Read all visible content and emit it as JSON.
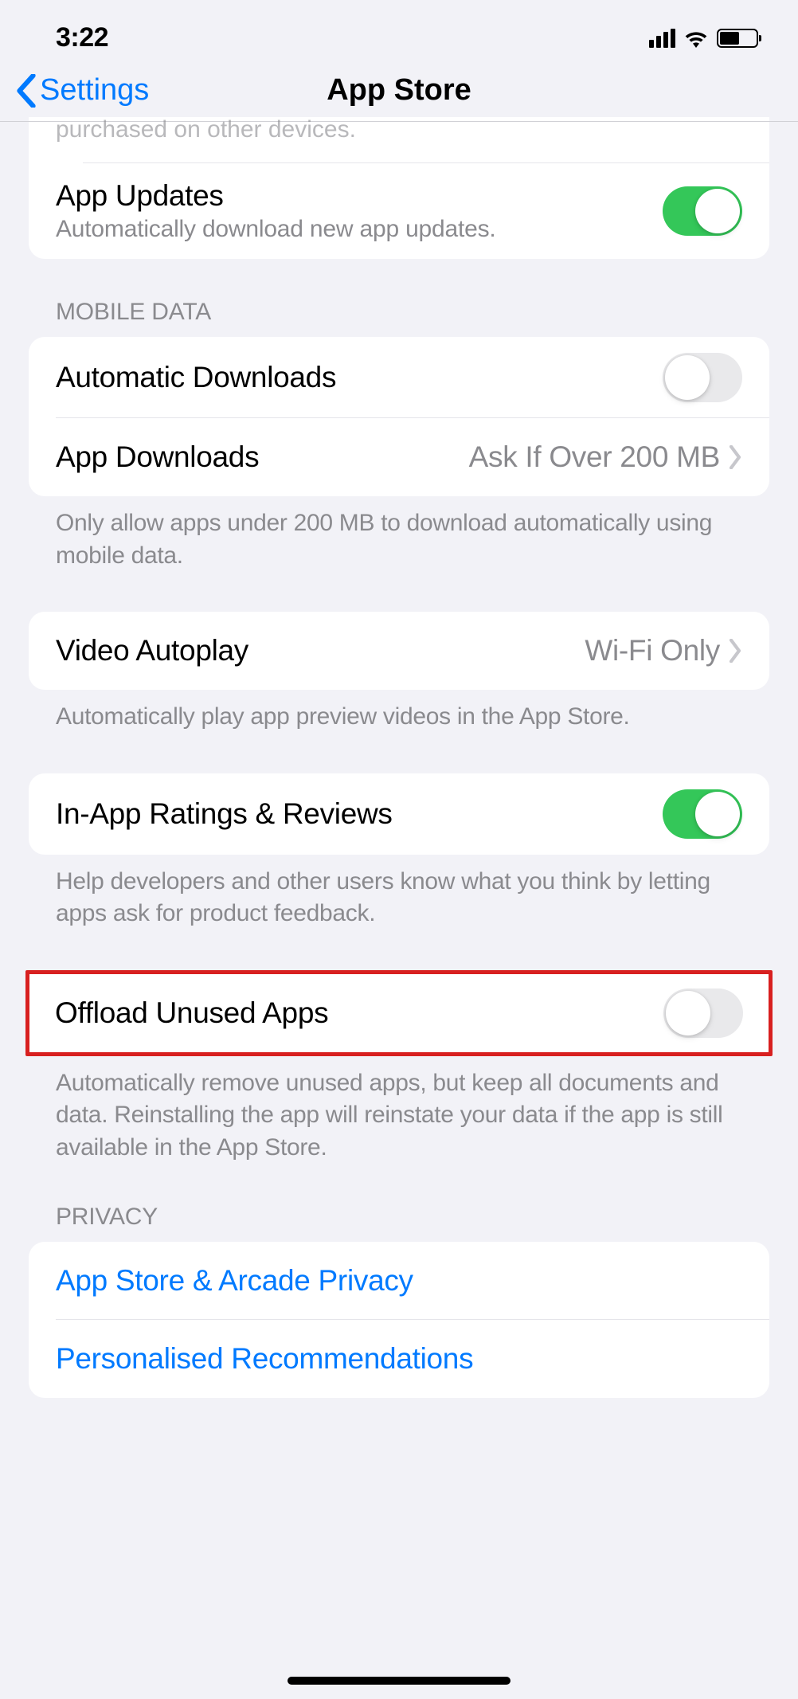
{
  "status_bar": {
    "time": "3:22"
  },
  "nav": {
    "back_label": "Settings",
    "title": "App Store"
  },
  "truncated_section": {
    "partial_text": "purchased on other devices."
  },
  "app_updates": {
    "title": "App Updates",
    "subtitle": "Automatically download new app updates.",
    "toggle_on": true
  },
  "mobile_data": {
    "header": "MOBILE DATA",
    "auto_downloads": {
      "title": "Automatic Downloads",
      "toggle_on": false
    },
    "app_downloads": {
      "title": "App Downloads",
      "value": "Ask If Over 200 MB"
    },
    "footer": "Only allow apps under 200 MB to download automatically using mobile data."
  },
  "video_autoplay": {
    "title": "Video Autoplay",
    "value": "Wi-Fi Only",
    "footer": "Automatically play app preview videos in the App Store."
  },
  "ratings": {
    "title": "In-App Ratings & Reviews",
    "toggle_on": true,
    "footer": "Help developers and other users know what you think by letting apps ask for product feedback."
  },
  "offload": {
    "title": "Offload Unused Apps",
    "toggle_on": false,
    "footer": "Automatically remove unused apps, but keep all documents and data. Reinstalling the app will reinstate your data if the app is still available in the App Store."
  },
  "privacy": {
    "header": "PRIVACY",
    "items": [
      {
        "label": "App Store & Arcade Privacy"
      },
      {
        "label": "Personalised Recommendations"
      }
    ]
  }
}
